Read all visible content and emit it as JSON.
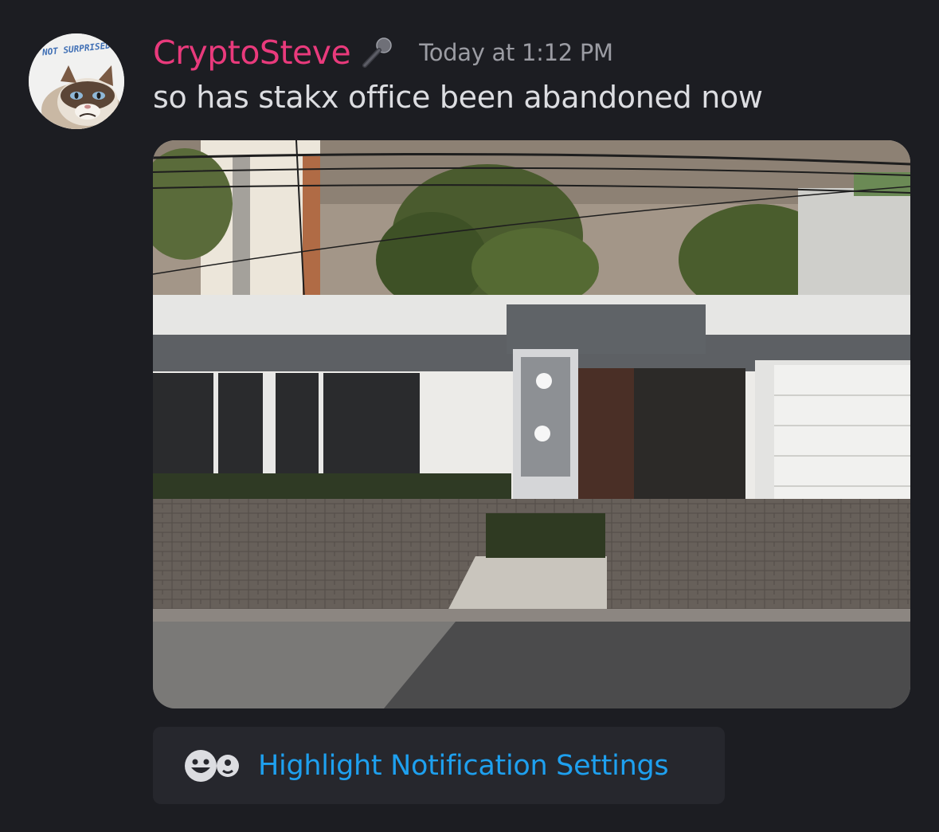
{
  "message": {
    "author": "CryptoSteve",
    "author_color": "#e93a7c",
    "timestamp": "Today at 1:12 PM",
    "text": "so has stakx office been abandoned now",
    "avatar": {
      "caption": "NOT SURPRISED",
      "description": "grumpy-cat-avatar"
    },
    "badge_icon": "microphone-icon",
    "attachment": {
      "type": "image",
      "subject": "single-story building with garage, parking lot and street"
    }
  },
  "action": {
    "icon": "emoji-mention-icon",
    "label": "Highlight Notification Settings",
    "color": "#1ea0ef"
  },
  "theme": {
    "background": "#1c1d22",
    "button_background": "#26272d",
    "text_color": "#dcdde1",
    "muted_color": "#9b9ca3"
  }
}
